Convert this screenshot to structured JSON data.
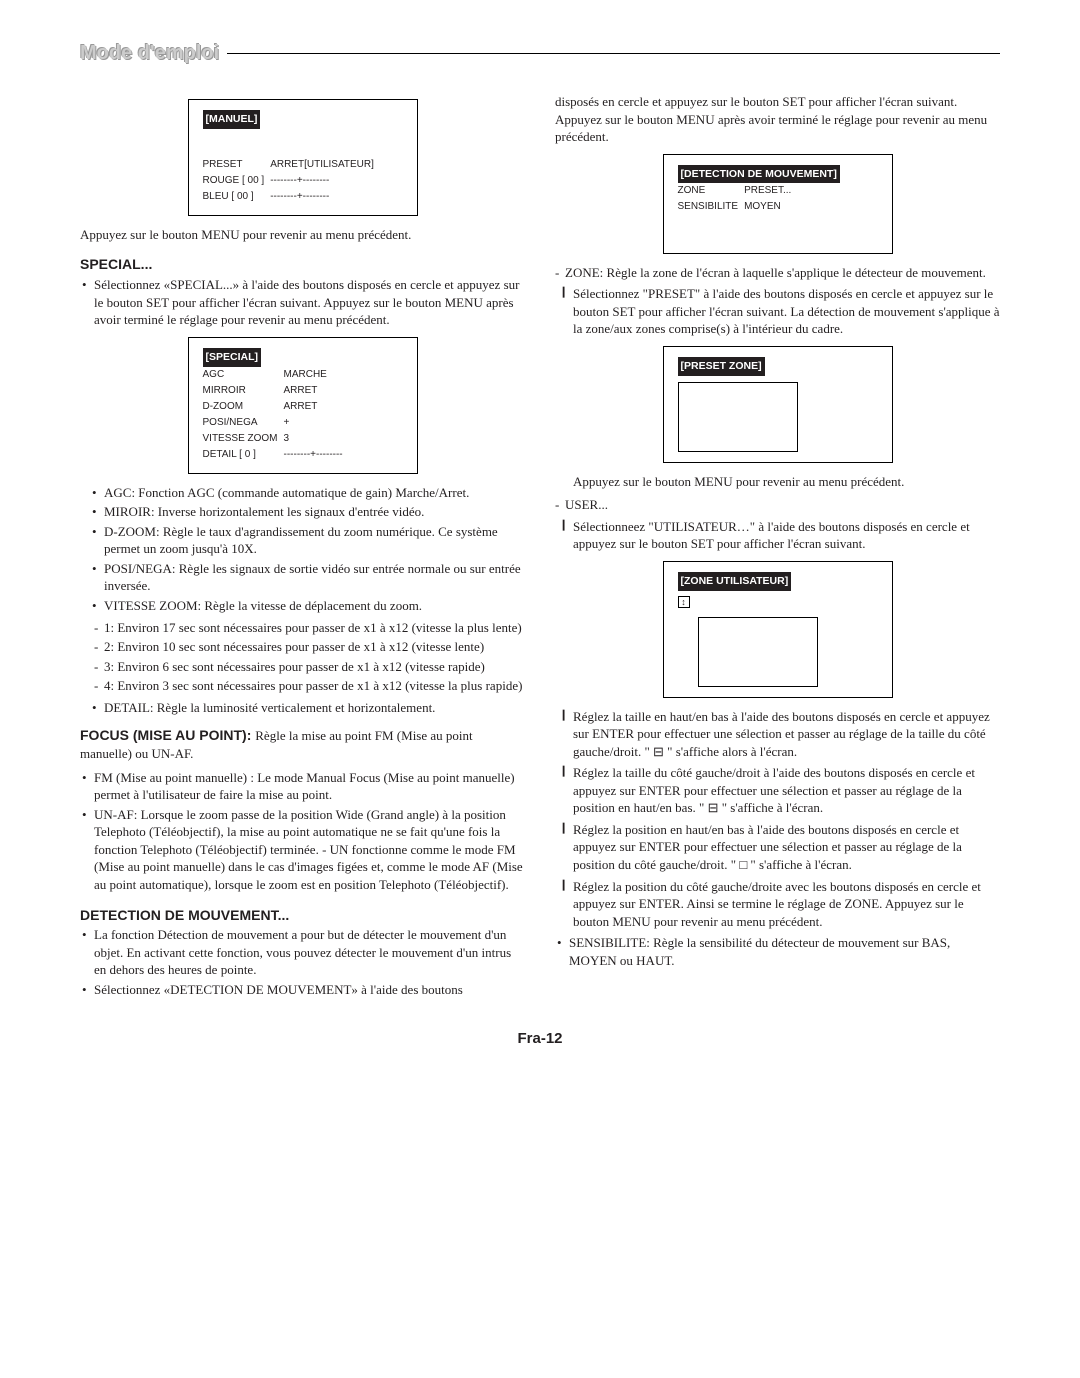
{
  "header": {
    "title": "Mode d'emploi"
  },
  "left": {
    "box_manuel": {
      "title": "[MANUEL]",
      "rows": [
        [
          "PRESET",
          "ARRET[UTILISATEUR]"
        ],
        [
          "ROUGE [ 00 ]",
          "--------+--------"
        ],
        [
          "BLEU   [ 00 ]",
          "--------+--------"
        ]
      ]
    },
    "after_manuel": "Appuyez sur le bouton MENU pour revenir au menu précédent.",
    "special_head": "SPECIAL...",
    "special_bullet": "Sélectionnez «SPECIAL...» à l'aide des boutons disposés en cercle et appuyez sur le bouton SET pour afficher l'écran suivant. Appuyez sur le bouton MENU après avoir terminé le réglage pour revenir au menu précédent.",
    "box_special": {
      "title": "[SPECIAL]",
      "rows": [
        [
          "AGC",
          "MARCHE"
        ],
        [
          "MIRROIR",
          "ARRET"
        ],
        [
          "D-ZOOM",
          "ARRET"
        ],
        [
          "POSI/NEGA",
          "+"
        ],
        [
          "VITESSE ZOOM",
          "3"
        ],
        [
          "DETAIL [ 0 ]",
          "--------+--------"
        ]
      ]
    },
    "special_items": [
      "AGC: Fonction AGC (commande automatique de gain) Marche/Arret.",
      "MIROIR: Inverse horizontalement les signaux d'entrée vidéo.",
      "D-ZOOM: Règle le taux d'agrandissement du zoom numérique. Ce système permet un zoom jusqu'à 10X.",
      "POSI/NEGA: Règle les signaux de sortie vidéo sur entrée normale ou sur entrée inversée.",
      "VITESSE ZOOM: Règle la vitesse de déplacement du zoom."
    ],
    "speeds": [
      "1: Environ 17 sec sont nécessaires pour passer de x1 à x12 (vitesse la plus lente)",
      "2: Environ 10 sec sont nécessaires pour passer de x1 à x12 (vitesse lente)",
      "3: Environ 6 sec sont nécessaires pour passer de x1 à x12 (vitesse rapide)",
      "4: Environ 3 sec sont nécessaires pour passer de x1 à x12 (vitesse la plus rapide)"
    ],
    "detail": "DETAIL: Règle la luminosité verticalement et horizontalement.",
    "focus_head": "FOCUS (MISE AU POINT): ",
    "focus_tail": "Règle la mise au point FM (Mise au point manuelle) ou UN-AF.",
    "focus_items": [
      "FM (Mise au point manuelle) : Le mode Manual Focus (Mise au point manuelle) permet à l'utilisateur de faire la mise au point.",
      "UN-AF: Lorsque le zoom passe de la position Wide (Grand angle) à la position Telephoto (Téléobjectif), la mise au point automatique ne se fait qu'une fois la fonction Telephoto (Téléobjectif) terminée. - UN fonctionne comme le mode FM (Mise au point manuelle) dans le cas d'images figées et, comme le mode AF (Mise au point automatique), lorsque le zoom est en position Telephoto (Téléobjectif)."
    ],
    "detect_head": "DETECTION DE MOUVEMENT...",
    "detect_items": [
      "La fonction Détection de mouvement a pour but de détecter le mouvement d'un objet. En activant cette fonction, vous pouvez détecter le mouvement d'un intrus en dehors des heures de pointe.",
      "Sélectionnez «DETECTION DE MOUVEMENT» à l'aide des boutons"
    ]
  },
  "right": {
    "top_para": "disposés en cercle et appuyez sur le bouton SET pour afficher l'écran suivant. Appuyez sur le bouton MENU après avoir terminé le réglage pour revenir au menu précédent.",
    "box_detect": {
      "title": "[DETECTION DE MOUVEMENT]",
      "rows": [
        [
          "ZONE",
          "PRESET..."
        ],
        [
          "SENSIBILITE",
          "MOYEN"
        ]
      ]
    },
    "zone_dash": "ZONE: Règle la zone de l'écran à laquelle s'applique le détecteur de mouvement.",
    "zone_bar": "Sélectionnez \"PRESET\" à l'aide des boutons disposés en cercle et appuyez sur le bouton SET pour afficher l'écran suivant. La détection de mouvement s'applique à la zone/aux zones comprise(s) à l'intérieur du cadre.",
    "box_preset": {
      "title": "[PRESET ZONE]"
    },
    "preset_after": "Appuyez sur le bouton MENU pour revenir au menu précédent.",
    "user_dash": "USER...",
    "user_bar": "Sélectionneez \"UTILISATEUR…\" à l'aide des boutons disposés en cercle et appuyez sur le bouton SET pour afficher l'écran suivant.",
    "box_user": {
      "title": "[ZONE UTILISATEUR]"
    },
    "user_steps": [
      "Réglez la taille en haut/en bas à l'aide des boutons disposés en cercle et appuyez sur ENTER pour effectuer une sélection et passer au réglage de la taille du côté gauche/droit. \" ⊟ \" s'affiche alors à l'écran.",
      "Réglez la taille du côté gauche/droit à l'aide des boutons disposés en cercle et appuyez sur ENTER pour effectuer une sélection et passer au réglage de la position en haut/en bas. \" ⊟ \" s'affiche à l'écran.",
      "Réglez la position en haut/en bas à l'aide des boutons disposés en cercle et appuyez sur ENTER pour effectuer une sélection et passer au réglage de la position du côté gauche/droit. \" □ \" s'affiche à l'écran.",
      "Réglez la position du côté gauche/droite avec les boutons disposés en cercle et appuyez sur ENTER. Ainsi se termine le réglage de ZONE. Appuyez sur le bouton MENU pour revenir au menu précédent."
    ],
    "sens_bullet": "SENSIBILITE: Règle la sensibilité du détecteur de mouvement sur BAS, MOYEN ou HAUT."
  },
  "footer": "Fra-12"
}
